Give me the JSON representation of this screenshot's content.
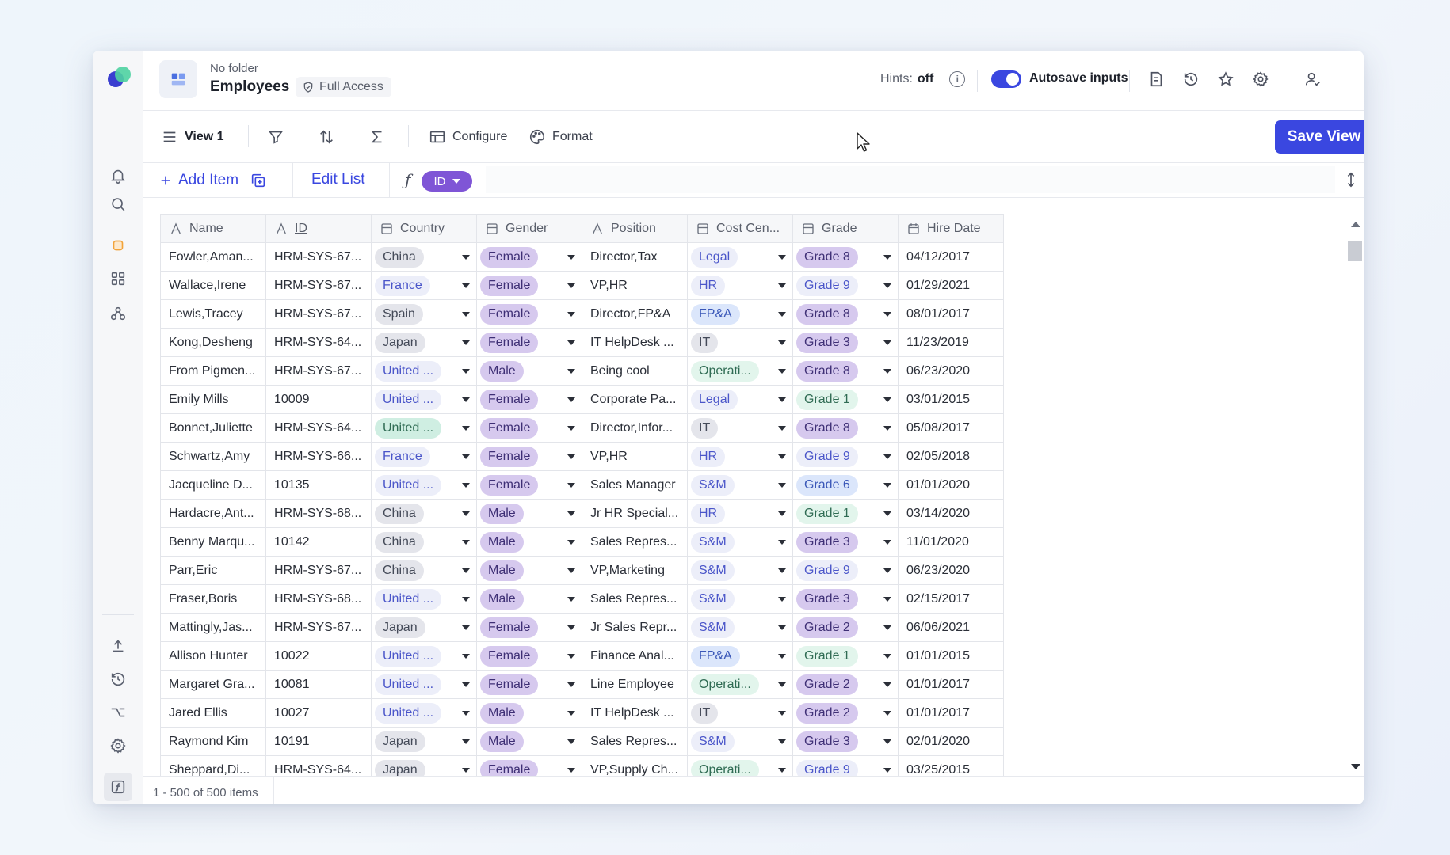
{
  "header": {
    "folder": "No folder",
    "title": "Employees",
    "access": "Full Access",
    "hints_label": "Hints:",
    "hints_value": "off",
    "autosave_label": "Autosave inputs",
    "autosave_on": true
  },
  "toolbar": {
    "view_label": "View 1",
    "configure_label": "Configure",
    "format_label": "Format",
    "save_label": "Save View"
  },
  "subbar": {
    "add_item_label": "Add Item",
    "edit_list_label": "Edit List",
    "formula_pill": "ID"
  },
  "colors": {
    "accent": "#3a47e0",
    "purple_pill": "#d6c9ee",
    "purple_text": "#3e2f75",
    "lavender_pill": "#eceef9",
    "lavender_text": "#4a55c9",
    "blue_pill": "#dbe6fb",
    "blue_text": "#3a57b8",
    "green_pill": "#e2f5ec",
    "green_text": "#2f6b53",
    "teal_pill": "#cfeee2",
    "grey_pill": "#e4e5eb",
    "grey_text": "#444a58"
  },
  "table": {
    "columns": [
      {
        "key": "name",
        "label": "Name",
        "icon": "text-icon"
      },
      {
        "key": "id",
        "label": "ID",
        "icon": "text-icon"
      },
      {
        "key": "country",
        "label": "Country",
        "icon": "list-icon"
      },
      {
        "key": "gender",
        "label": "Gender",
        "icon": "list-icon"
      },
      {
        "key": "position",
        "label": "Position",
        "icon": "text-icon"
      },
      {
        "key": "cost",
        "label": "Cost Cen...",
        "icon": "list-icon"
      },
      {
        "key": "grade",
        "label": "Grade",
        "icon": "list-icon"
      },
      {
        "key": "hire",
        "label": "Hire Date",
        "icon": "calendar-icon"
      }
    ],
    "rows": [
      {
        "name": "Fowler,Aman...",
        "id": "HRM-SYS-67...",
        "country": "China",
        "gender": "Female",
        "position": "Director,Tax",
        "cost": "Legal",
        "grade": "Grade 8",
        "hire": "04/12/2017"
      },
      {
        "name": "Wallace,Irene",
        "id": "HRM-SYS-67...",
        "country": "France",
        "gender": "Female",
        "position": "VP,HR",
        "cost": "HR",
        "grade": "Grade 9",
        "hire": "01/29/2021"
      },
      {
        "name": "Lewis,Tracey",
        "id": "HRM-SYS-67...",
        "country": "Spain",
        "gender": "Female",
        "position": "Director,FP&A",
        "cost": "FP&A",
        "grade": "Grade 8",
        "hire": "08/01/2017"
      },
      {
        "name": "Kong,Desheng",
        "id": "HRM-SYS-64...",
        "country": "Japan",
        "gender": "Female",
        "position": "IT HelpDesk ...",
        "cost": "IT",
        "grade": "Grade 3",
        "hire": "11/23/2019"
      },
      {
        "name": "From Pigmen...",
        "id": "HRM-SYS-67...",
        "country": "United ...",
        "gender": "Male",
        "position": "Being cool",
        "cost": "Operati...",
        "grade": "Grade 8",
        "hire": "06/23/2020"
      },
      {
        "name": "Emily Mills",
        "id": "10009",
        "country": "United ...",
        "gender": "Female",
        "position": "Corporate Pa...",
        "cost": "Legal",
        "grade": "Grade 1",
        "hire": "03/01/2015"
      },
      {
        "name": "Bonnet,Juliette",
        "id": "HRM-SYS-64...",
        "country": "United ...",
        "gender": "Female",
        "position": "Director,Infor...",
        "cost": "IT",
        "grade": "Grade 8",
        "hire": "05/08/2017"
      },
      {
        "name": "Schwartz,Amy",
        "id": "HRM-SYS-66...",
        "country": "France",
        "gender": "Female",
        "position": "VP,HR",
        "cost": "HR",
        "grade": "Grade 9",
        "hire": "02/05/2018"
      },
      {
        "name": "Jacqueline D...",
        "id": "10135",
        "country": "United ...",
        "gender": "Female",
        "position": "Sales Manager",
        "cost": "S&M",
        "grade": "Grade 6",
        "hire": "01/01/2020"
      },
      {
        "name": "Hardacre,Ant...",
        "id": "HRM-SYS-68...",
        "country": "China",
        "gender": "Male",
        "position": "Jr HR Special...",
        "cost": "HR",
        "grade": "Grade 1",
        "hire": "03/14/2020"
      },
      {
        "name": "Benny Marqu...",
        "id": "10142",
        "country": "China",
        "gender": "Male",
        "position": "Sales Repres...",
        "cost": "S&M",
        "grade": "Grade 3",
        "hire": "11/01/2020"
      },
      {
        "name": "Parr,Eric",
        "id": "HRM-SYS-67...",
        "country": "China",
        "gender": "Male",
        "position": "VP,Marketing",
        "cost": "S&M",
        "grade": "Grade 9",
        "hire": "06/23/2020"
      },
      {
        "name": "Fraser,Boris",
        "id": "HRM-SYS-68...",
        "country": "United ...",
        "gender": "Male",
        "position": "Sales Repres...",
        "cost": "S&M",
        "grade": "Grade 3",
        "hire": "02/15/2017"
      },
      {
        "name": "Mattingly,Jas...",
        "id": "HRM-SYS-67...",
        "country": "Japan",
        "gender": "Female",
        "position": "Jr Sales Repr...",
        "cost": "S&M",
        "grade": "Grade 2",
        "hire": "06/06/2021"
      },
      {
        "name": "Allison Hunter",
        "id": "10022",
        "country": "United ...",
        "gender": "Female",
        "position": "Finance Anal...",
        "cost": "FP&A",
        "grade": "Grade 1",
        "hire": "01/01/2015"
      },
      {
        "name": "Margaret Gra...",
        "id": "10081",
        "country": "United ...",
        "gender": "Female",
        "position": "Line Employee",
        "cost": "Operati...",
        "grade": "Grade 2",
        "hire": "01/01/2017"
      },
      {
        "name": "Jared Ellis",
        "id": "10027",
        "country": "United ...",
        "gender": "Male",
        "position": "IT HelpDesk ...",
        "cost": "IT",
        "grade": "Grade 2",
        "hire": "01/01/2017"
      },
      {
        "name": "Raymond Kim",
        "id": "10191",
        "country": "Japan",
        "gender": "Male",
        "position": "Sales Repres...",
        "cost": "S&M",
        "grade": "Grade 3",
        "hire": "02/01/2020"
      },
      {
        "name": "Sheppard,Di...",
        "id": "HRM-SYS-64...",
        "country": "Japan",
        "gender": "Female",
        "position": "VP,Supply Ch...",
        "cost": "Operati...",
        "grade": "Grade 9",
        "hire": "03/25/2015"
      }
    ]
  },
  "footer": {
    "range_label": "1 - 500 of 500 items"
  }
}
